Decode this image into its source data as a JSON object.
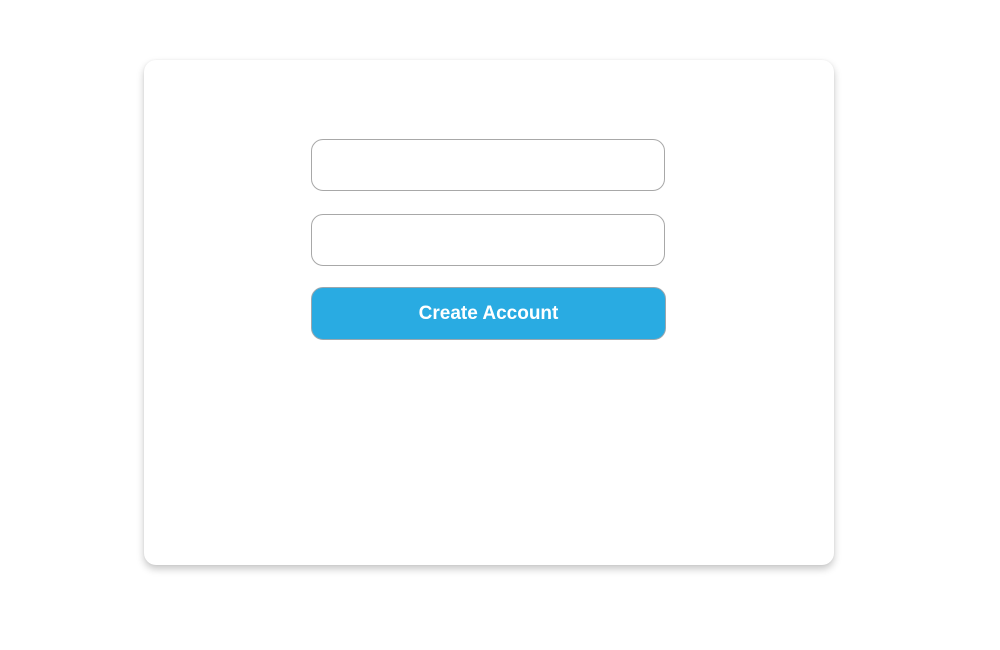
{
  "form": {
    "field_1": {
      "value": "",
      "placeholder": ""
    },
    "field_2": {
      "value": "",
      "placeholder": ""
    },
    "submit_label": "Create Account"
  },
  "colors": {
    "button_background": "#29abe2",
    "button_text": "#ffffff",
    "field_border": "#a8a8a8",
    "card_background": "#ffffff"
  }
}
